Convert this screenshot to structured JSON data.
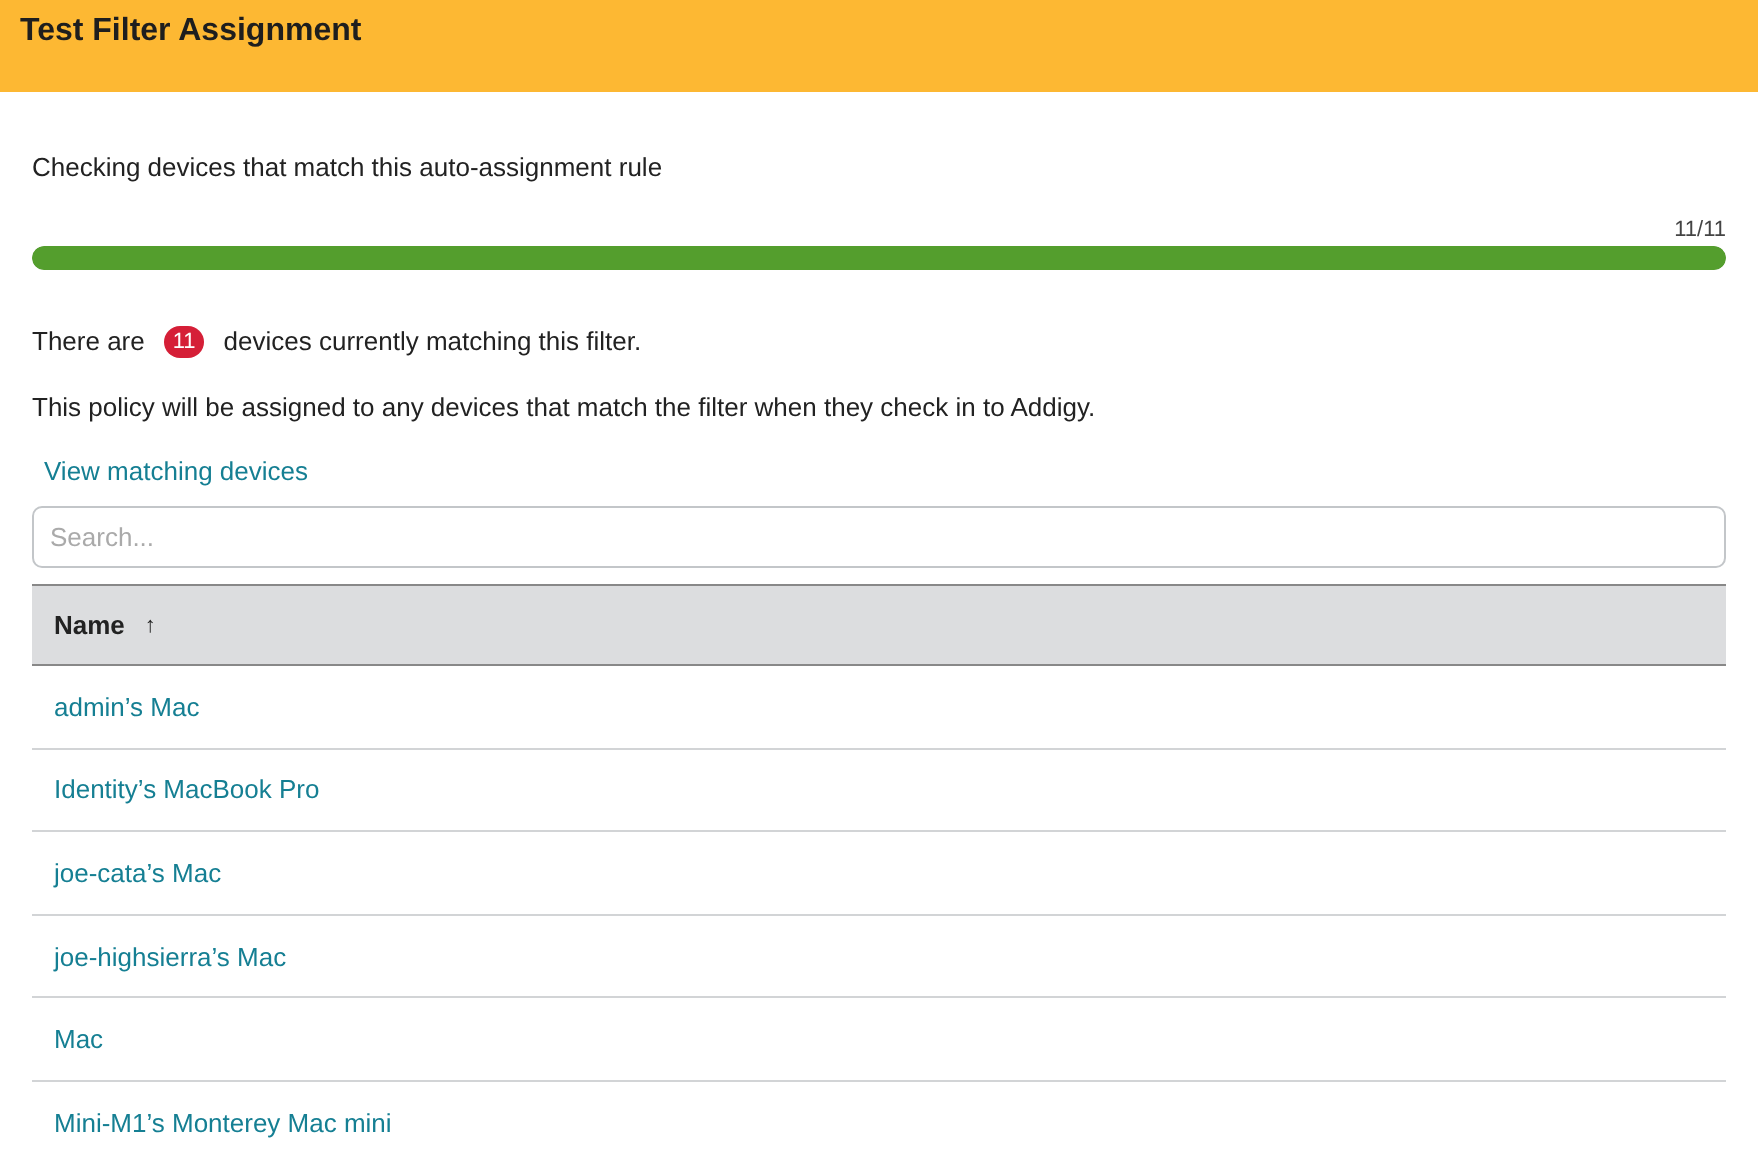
{
  "header": {
    "title": "Test Filter Assignment"
  },
  "intro": "Checking devices that match this auto-assignment rule",
  "progress": {
    "reading": "11/11",
    "level": 1
  },
  "summary": {
    "prefix": "There are",
    "count": "11",
    "suffix": "devices currently matching this filter."
  },
  "note": "This policy will be assigned to any devices that match the filter when they check in to Addigy.",
  "link": "View matching devices",
  "search": {
    "placeholder": "Search..."
  },
  "table": {
    "columns": [
      {
        "label": "Name",
        "sort_icon": "↑"
      }
    ],
    "rows": [
      {
        "name": "admin’s Mac"
      },
      {
        "name": "Identity’s MacBook Pro"
      },
      {
        "name": "joe-cata’s Mac"
      },
      {
        "name": "joe-highsierra’s Mac"
      },
      {
        "name": "Mac"
      },
      {
        "name": "Mini-M1’s Monterey Mac mini"
      }
    ]
  }
}
